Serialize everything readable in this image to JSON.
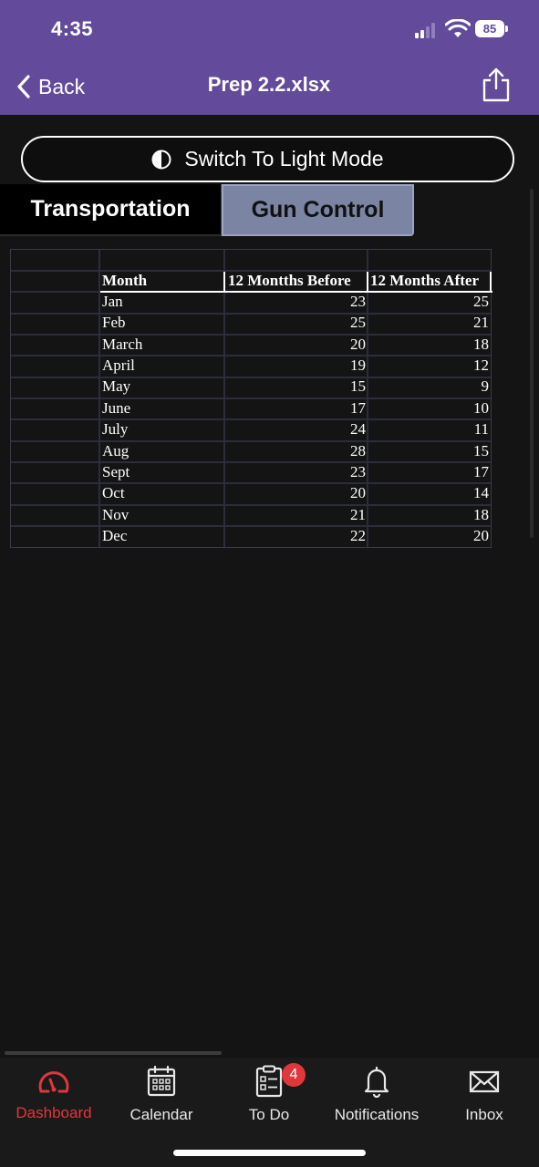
{
  "status_bar": {
    "time": "4:35",
    "battery": "85"
  },
  "nav_bar": {
    "back_label": "Back",
    "title": "Prep 2.2.xlsx"
  },
  "mode_button": {
    "label": "Switch To Light Mode"
  },
  "sheet_tabs": [
    {
      "label": "Transportation",
      "active": false
    },
    {
      "label": "Gun Control",
      "active": true
    }
  ],
  "table": {
    "headers": [
      "Month",
      "12 Montths Before",
      "12 Months After"
    ],
    "rows": [
      [
        "Jan",
        "23",
        "25"
      ],
      [
        "Feb",
        "25",
        "21"
      ],
      [
        "March",
        "20",
        "18"
      ],
      [
        "April",
        "19",
        "12"
      ],
      [
        "May",
        "15",
        "9"
      ],
      [
        "June",
        "17",
        "10"
      ],
      [
        "July",
        "24",
        "11"
      ],
      [
        "Aug",
        "28",
        "15"
      ],
      [
        "Sept",
        "23",
        "17"
      ],
      [
        "Oct",
        "20",
        "14"
      ],
      [
        "Nov",
        "21",
        "18"
      ],
      [
        "Dec",
        "22",
        "20"
      ]
    ]
  },
  "tab_bar": {
    "items": [
      {
        "label": "Dashboard",
        "icon": "gauge-icon",
        "active": true
      },
      {
        "label": "Calendar",
        "icon": "calendar-icon",
        "active": false
      },
      {
        "label": "To Do",
        "icon": "clipboard-icon",
        "active": false
      },
      {
        "label": "Notifications",
        "icon": "bell-icon",
        "active": false
      },
      {
        "label": "Inbox",
        "icon": "envelope-icon",
        "active": false
      }
    ],
    "todo_badge": "4"
  },
  "colors": {
    "header": "#634a9b",
    "accent": "#e0373a",
    "active_tab": "#7b84a3",
    "background": "#141414"
  }
}
